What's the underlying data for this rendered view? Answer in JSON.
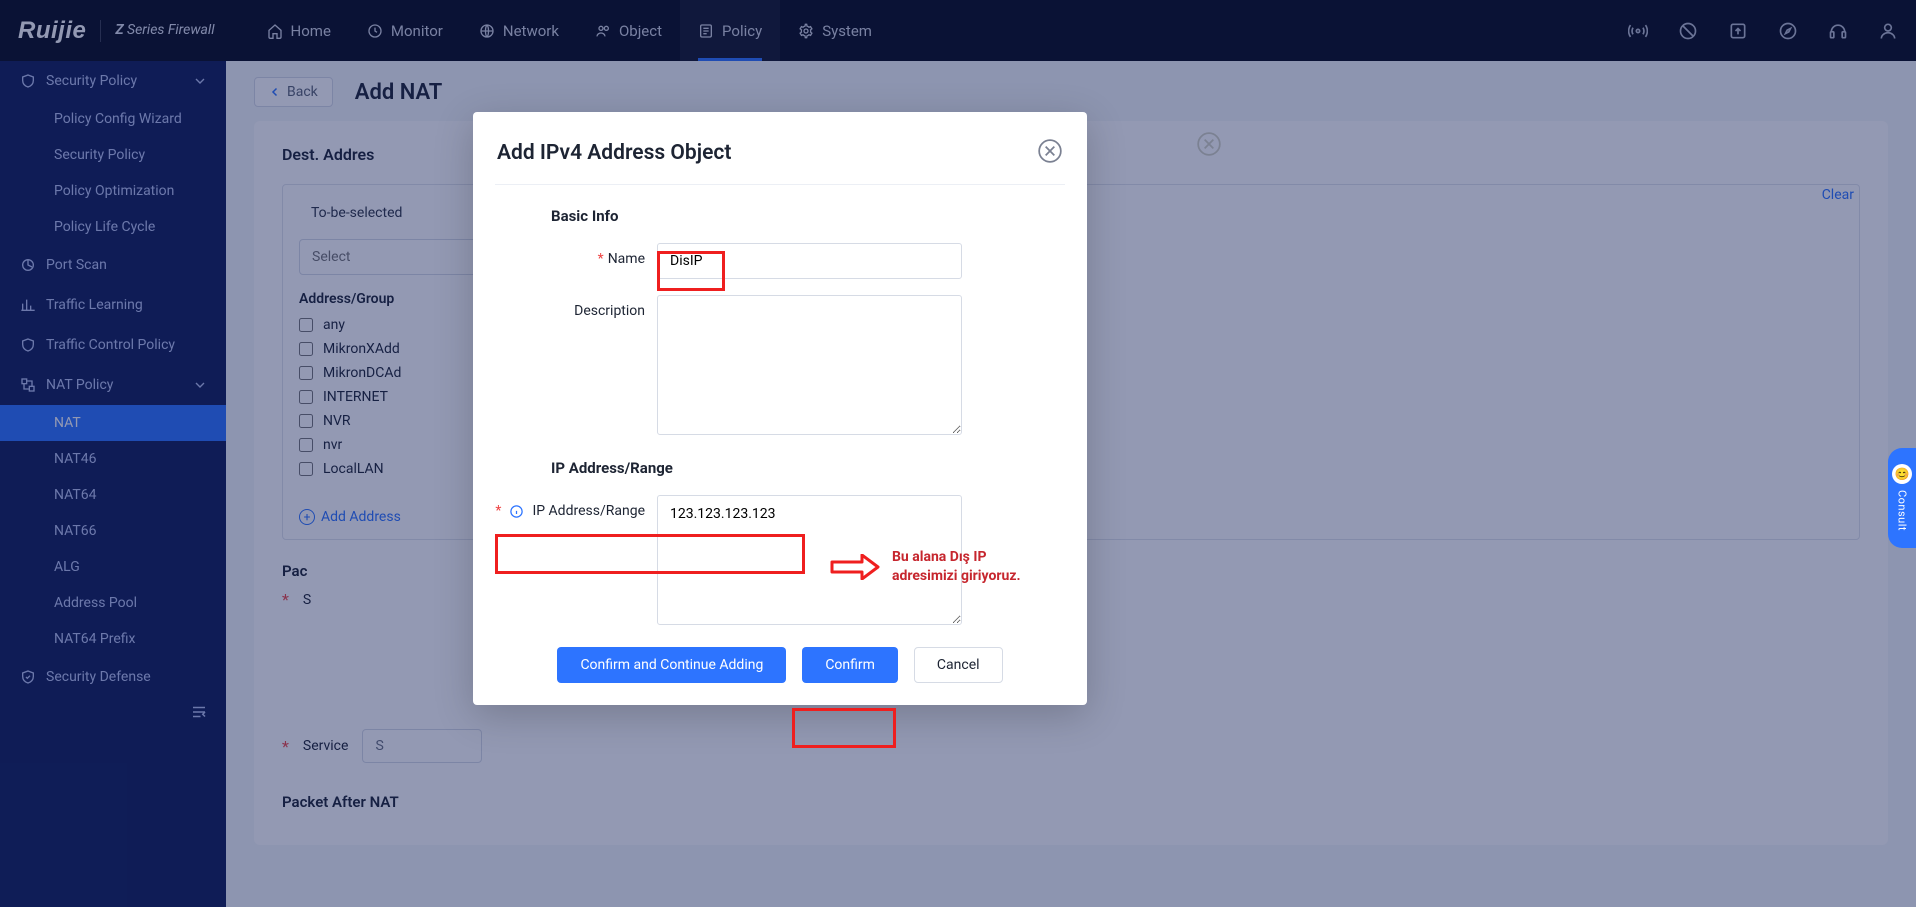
{
  "brand": {
    "name": "Ruijie",
    "product_prefix": "Z",
    "product": " Series Firewall"
  },
  "topnav": {
    "items": [
      {
        "label": "Home"
      },
      {
        "label": "Monitor"
      },
      {
        "label": "Network"
      },
      {
        "label": "Object"
      },
      {
        "label": "Policy"
      },
      {
        "label": "System"
      }
    ]
  },
  "sidebar": {
    "groups": [
      {
        "label": "Security Policy",
        "expandable": true,
        "children": [
          {
            "label": "Policy Config Wizard"
          },
          {
            "label": "Security Policy"
          },
          {
            "label": "Policy Optimization"
          },
          {
            "label": "Policy Life Cycle"
          }
        ]
      },
      {
        "label": "Port Scan"
      },
      {
        "label": "Traffic Learning"
      },
      {
        "label": "Traffic Control Policy"
      },
      {
        "label": "NAT Policy",
        "expandable": true,
        "children": [
          {
            "label": "NAT",
            "active": true
          },
          {
            "label": "NAT46"
          },
          {
            "label": "NAT64"
          },
          {
            "label": "NAT66"
          },
          {
            "label": "ALG"
          },
          {
            "label": "Address Pool"
          },
          {
            "label": "NAT64 Prefix"
          }
        ]
      },
      {
        "label": "Security Defense"
      }
    ]
  },
  "page": {
    "back": "Back",
    "title": "Add NAT",
    "dest_label_prefix": "Dest. Addres",
    "to_be_selected": "To-be-selected",
    "clear": "Clear",
    "select_placeholder": "Select",
    "addr_group_header": "Address/Group",
    "addr_items": [
      "any",
      "MikronXAdd",
      "MikronDCAd",
      "INTERNET",
      "NVR",
      "nvr",
      "LocalLAN"
    ],
    "add_address": "Add Address",
    "packet_section_prefix": "Pac",
    "src_row_prefix": "S",
    "service_label": "Service",
    "service_value_prefix": "S",
    "packet_after": "Packet After NAT"
  },
  "modal": {
    "title": "Add IPv4 Address Object",
    "basic_info": "Basic Info",
    "name_label": "Name",
    "name_value": "DisIP",
    "description_label": "Description",
    "description_value": "",
    "ip_range_section": "IP Address/Range",
    "ip_range_label": "IP Address/Range",
    "ip_range_value": "123.123.123.123",
    "buttons": {
      "confirm_continue": "Confirm and Continue Adding",
      "confirm": "Confirm",
      "cancel": "Cancel"
    }
  },
  "annotation": {
    "text_line1": "Bu alana Dış IP",
    "text_line2": "adresimizi giriyoruz."
  },
  "consult": {
    "label": "Consult"
  }
}
